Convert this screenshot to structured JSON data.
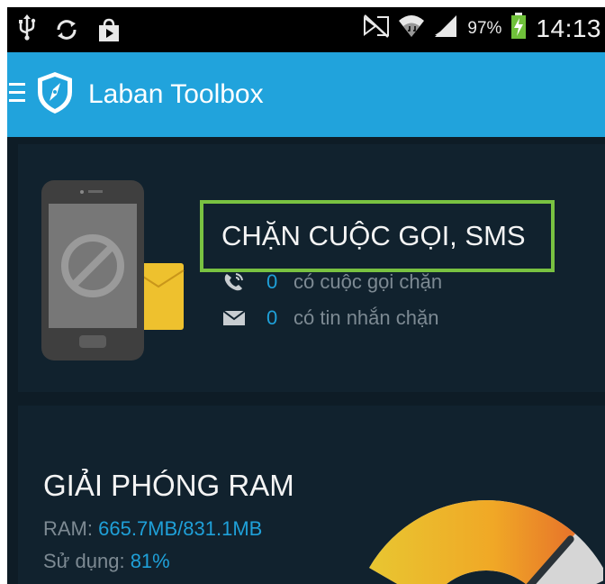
{
  "status_bar": {
    "icons": [
      "usb-icon",
      "sync-icon",
      "store-icon",
      "no-sim-icon",
      "wifi-icon",
      "signal-icon",
      "battery-charging-icon"
    ],
    "battery_percent": "97%",
    "time": "14:13"
  },
  "action_bar": {
    "title": "Laban Toolbox",
    "icons": [
      "menu-icon",
      "shield-compass-logo-icon"
    ]
  },
  "block_card": {
    "title": "CHẶN CUỘC GỌI, SMS",
    "calls": {
      "count": "0",
      "label": "có cuộc gọi chặn"
    },
    "sms": {
      "count": "0",
      "label": "có tin nhắn chặn"
    },
    "colors": {
      "highlight": "#79c241",
      "accent": "#1fa0d8"
    }
  },
  "ram_card": {
    "title": "GIẢI PHÓNG RAM",
    "ram_label": "RAM: ",
    "ram_value": "665.7MB/831.1MB",
    "usage_label": "Sử dụng: ",
    "usage_value": "81%",
    "usage_fraction": 0.81
  },
  "colors": {
    "action_bar": "#21a3dc",
    "card_bg": "#11222e",
    "screen_bg": "#0e1c26"
  }
}
